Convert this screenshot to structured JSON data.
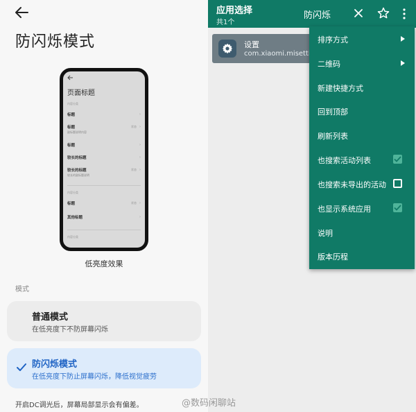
{
  "left": {
    "page_title": "防闪烁模式",
    "preview": {
      "title": "页面标题",
      "cat1": "内容分类",
      "rows": [
        {
          "title": "标题",
          "sub": "",
          "value": ""
        },
        {
          "title": "标题",
          "sub": "副标题说明内容",
          "value": "状态"
        },
        {
          "title": "标题",
          "sub": "",
          "value": ""
        },
        {
          "title": "较长的标题",
          "sub": "",
          "value": ""
        },
        {
          "title": "较长的标题",
          "sub": "较长的副标题说明",
          "value": "状态"
        }
      ],
      "cat2": "内容分类",
      "rows2": [
        {
          "title": "标题",
          "sub": "",
          "value": "状态"
        },
        {
          "title": "其他标题",
          "sub": "",
          "value": ""
        }
      ],
      "cat3": "内容分类"
    },
    "effect_caption": "低亮度效果",
    "section_label": "模式",
    "modes": [
      {
        "name": "普通模式",
        "desc": "在低亮度下不防屏幕闪烁",
        "selected": false
      },
      {
        "name": "防闪烁模式",
        "desc": "在低亮度下防止屏幕闪烁，降低视觉疲劳",
        "selected": true
      }
    ],
    "footnote": "开启DC调光后，屏幕局部显示会有偏差。",
    "accent_color": "#1f63c4"
  },
  "right": {
    "appbar": {
      "title": "应用选择",
      "count": "共1个",
      "filter": "防闪烁",
      "color": "#107a66"
    },
    "app": {
      "name": "设置",
      "package": "com.xiaomi.misettings"
    },
    "menu": {
      "items": [
        {
          "label": "排序方式",
          "kind": "submenu"
        },
        {
          "label": "二维码",
          "kind": "submenu"
        },
        {
          "label": "新建快捷方式",
          "kind": "action"
        },
        {
          "label": "回到顶部",
          "kind": "action"
        },
        {
          "label": "刷新列表",
          "kind": "action"
        },
        {
          "label": "也搜索活动列表",
          "kind": "check",
          "checked": true
        },
        {
          "label": "也搜索未导出的活动",
          "kind": "check",
          "checked": false
        },
        {
          "label": "也显示系统应用",
          "kind": "check",
          "checked": true
        },
        {
          "label": "说明",
          "kind": "action"
        },
        {
          "label": "版本历程",
          "kind": "action"
        }
      ]
    }
  },
  "watermark": "@数码闲聊站"
}
